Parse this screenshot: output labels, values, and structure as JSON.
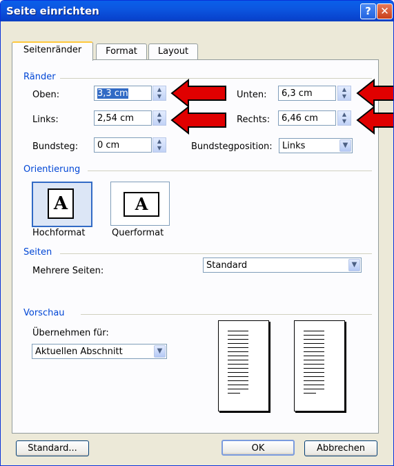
{
  "window": {
    "title": "Seite einrichten"
  },
  "tabs": [
    "Seitenränder",
    "Format",
    "Layout"
  ],
  "margins": {
    "group_label": "Ränder",
    "top_label": "Oben:",
    "top_value": "3,3 cm",
    "bottom_label": "Unten:",
    "bottom_value": "6,3 cm",
    "left_label": "Links:",
    "left_value": "2,54 cm",
    "right_label": "Rechts:",
    "right_value": "6,46 cm",
    "gutter_label": "Bundsteg:",
    "gutter_value": "0 cm",
    "gutter_pos_label": "Bundstegposition:",
    "gutter_pos_value": "Links"
  },
  "orientation": {
    "group_label": "Orientierung",
    "portrait_label": "Hochformat",
    "landscape_label": "Querformat",
    "icon_letter": "A",
    "selected": "Hochformat"
  },
  "pages": {
    "group_label": "Seiten",
    "multiple_label": "Mehrere Seiten:",
    "multiple_value": "Standard"
  },
  "preview": {
    "group_label": "Vorschau",
    "apply_label": "Übernehmen für:",
    "apply_value": "Aktuellen Abschnitt"
  },
  "buttons": {
    "default": "Standard...",
    "ok": "OK",
    "cancel": "Abbrechen"
  },
  "colors": {
    "arrow": "#e00000",
    "title_bar": "#0a5fea",
    "group_label": "#0046d5"
  },
  "icons": [
    "help-icon",
    "close-icon",
    "spin-up-icon",
    "spin-down-icon",
    "dropdown-arrow-icon",
    "red-arrow-icon"
  ]
}
